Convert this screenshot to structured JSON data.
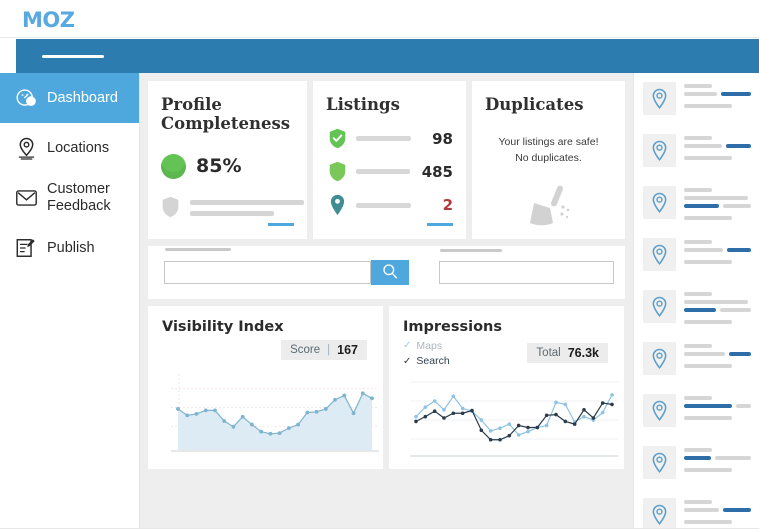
{
  "brand": {
    "logo_text": "MOZ",
    "accent_blue": "#4fa8dd",
    "header_blue": "#2c7cb0"
  },
  "sidebar": {
    "items": [
      {
        "label": "Dashboard",
        "icon": "dashboard-gauge-icon",
        "active": true
      },
      {
        "label": "Locations",
        "icon": "location-pin-icon",
        "active": false
      },
      {
        "label": "Customer Feedback",
        "icon": "envelope-icon",
        "active": false
      },
      {
        "label": "Publish",
        "icon": "edit-document-icon",
        "active": false
      }
    ]
  },
  "cards": {
    "profile_completeness": {
      "title": "Profile Completeness",
      "percent": "85%",
      "circle_color": "#63c354",
      "shield_icon": "shield-icon"
    },
    "listings": {
      "title": "Listings",
      "rows": [
        {
          "icon": "shield-check-icon",
          "icon_color": "#63c354",
          "value": "98",
          "danger": false
        },
        {
          "icon": "shield-icon",
          "icon_color": "#7cc75a",
          "value": "485",
          "danger": false
        },
        {
          "icon": "location-pin-icon",
          "icon_color": "#3f8d93",
          "value": "2",
          "danger": true
        }
      ]
    },
    "duplicates": {
      "title": "Duplicates",
      "message_line1": "Your listings are safe!",
      "message_line2": "No duplicates.",
      "icon": "broom-sweep-icon"
    }
  },
  "search": {
    "input_value": "",
    "input_placeholder": "",
    "button_icon": "search-icon",
    "secondary_input_value": "",
    "secondary_input_placeholder": ""
  },
  "chart_data": [
    {
      "type": "area",
      "title": "Visibility Index",
      "badge_label": "Score",
      "badge_separator": "|",
      "badge_value": "167",
      "xlabel": "",
      "ylabel": "",
      "grid": true,
      "ylim": [
        0,
        100
      ],
      "line_color": "#7fb4cf",
      "fill_color": "#dcebf4",
      "x": [
        1,
        2,
        3,
        4,
        5,
        6,
        7,
        8,
        9,
        10,
        11,
        12,
        13,
        14,
        15,
        16,
        17,
        18,
        19,
        20,
        21,
        22
      ],
      "values": [
        55,
        46,
        48,
        53,
        53,
        38,
        30,
        44,
        33,
        23,
        20,
        21,
        28,
        33,
        50,
        51,
        55,
        68,
        74,
        49,
        77,
        70
      ]
    },
    {
      "type": "line",
      "title": "Impressions",
      "badge_label": "Total",
      "badge_value": "76.3k",
      "legend": [
        {
          "label": "Maps",
          "checked": true,
          "color": "#9ccbe8"
        },
        {
          "label": "Search",
          "checked": true,
          "color": "#2b3b49"
        }
      ],
      "xlabel": "",
      "ylabel": "",
      "grid": true,
      "ylim": [
        0,
        100
      ],
      "x": [
        1,
        2,
        3,
        4,
        5,
        6,
        7,
        8,
        9,
        10,
        11,
        12,
        13,
        14,
        15,
        16,
        17,
        18,
        19,
        20,
        21,
        22
      ],
      "series": [
        {
          "name": "Maps",
          "color": "#8fc3e3",
          "values": [
            52,
            66,
            75,
            62,
            82,
            64,
            60,
            47,
            31,
            35,
            41,
            25,
            30,
            36,
            39,
            73,
            70,
            44,
            52,
            47,
            58,
            84
          ]
        },
        {
          "name": "Search",
          "color": "#2b3b49",
          "values": [
            45,
            52,
            60,
            50,
            57,
            57,
            61,
            32,
            18,
            18,
            24,
            39,
            36,
            36,
            54,
            55,
            45,
            41,
            62,
            50,
            72,
            70
          ]
        }
      ]
    }
  ],
  "locations_panel": {
    "items": [
      {
        "icon": "location-pin-icon",
        "blue_bar_index": 1,
        "blue_bar_align": "right",
        "blue_bar_width": "46%",
        "line_count": 3
      },
      {
        "icon": "location-pin-icon",
        "blue_bar_index": 1,
        "blue_bar_align": "right",
        "blue_bar_width": "38%",
        "line_count": 3
      },
      {
        "icon": "location-pin-icon",
        "blue_bar_index": 2,
        "blue_bar_align": "left",
        "blue_bar_width": "52%",
        "line_count": 4
      },
      {
        "icon": "location-pin-icon",
        "blue_bar_index": 1,
        "blue_bar_align": "right",
        "blue_bar_width": "36%",
        "line_count": 3
      },
      {
        "icon": "location-pin-icon",
        "blue_bar_index": 2,
        "blue_bar_align": "left",
        "blue_bar_width": "48%",
        "line_count": 4
      },
      {
        "icon": "location-pin-icon",
        "blue_bar_index": 1,
        "blue_bar_align": "right",
        "blue_bar_width": "34%",
        "line_count": 3
      },
      {
        "icon": "location-pin-icon",
        "blue_bar_index": 1,
        "blue_bar_align": "left",
        "blue_bar_width": "72%",
        "line_count": 3
      },
      {
        "icon": "location-pin-icon",
        "blue_bar_index": 1,
        "blue_bar_align": "left",
        "blue_bar_width": "40%",
        "line_count": 3
      },
      {
        "icon": "location-pin-icon",
        "blue_bar_index": 1,
        "blue_bar_align": "right",
        "blue_bar_width": "42%",
        "line_count": 3
      }
    ]
  }
}
